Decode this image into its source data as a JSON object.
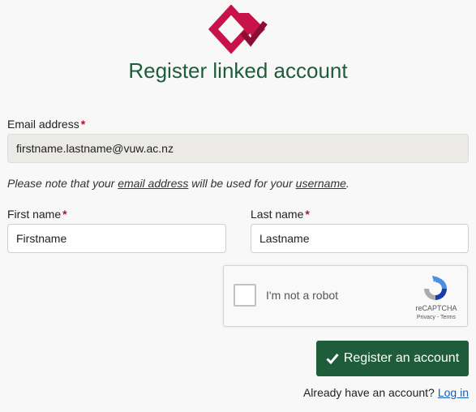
{
  "header": {
    "title": "Register linked account"
  },
  "form": {
    "email_label": "Email address",
    "email_value": "firstname.lastname@vuw.ac.nz",
    "required_mark": "*",
    "note_prefix": "Please note that your",
    "note_email": "email address",
    "note_middle": "will be used for your",
    "note_username": "username",
    "note_suffix": ".",
    "first_name_label": "First name",
    "first_name_value": "Firstname",
    "last_name_label": "Last name",
    "last_name_value": "Lastname"
  },
  "captcha": {
    "label": "I'm not a robot",
    "brand": "reCAPTCHA",
    "links": "Privacy - Terms"
  },
  "submit": {
    "label": "Register an account",
    "icon": "check-icon"
  },
  "footer": {
    "text": "Already have an account?",
    "link": "Log in"
  },
  "colors": {
    "brand_green": "#1f5d3a",
    "logo_red": "#c8124a",
    "required_red": "#b0102f",
    "link_blue": "#1a5fb4"
  }
}
